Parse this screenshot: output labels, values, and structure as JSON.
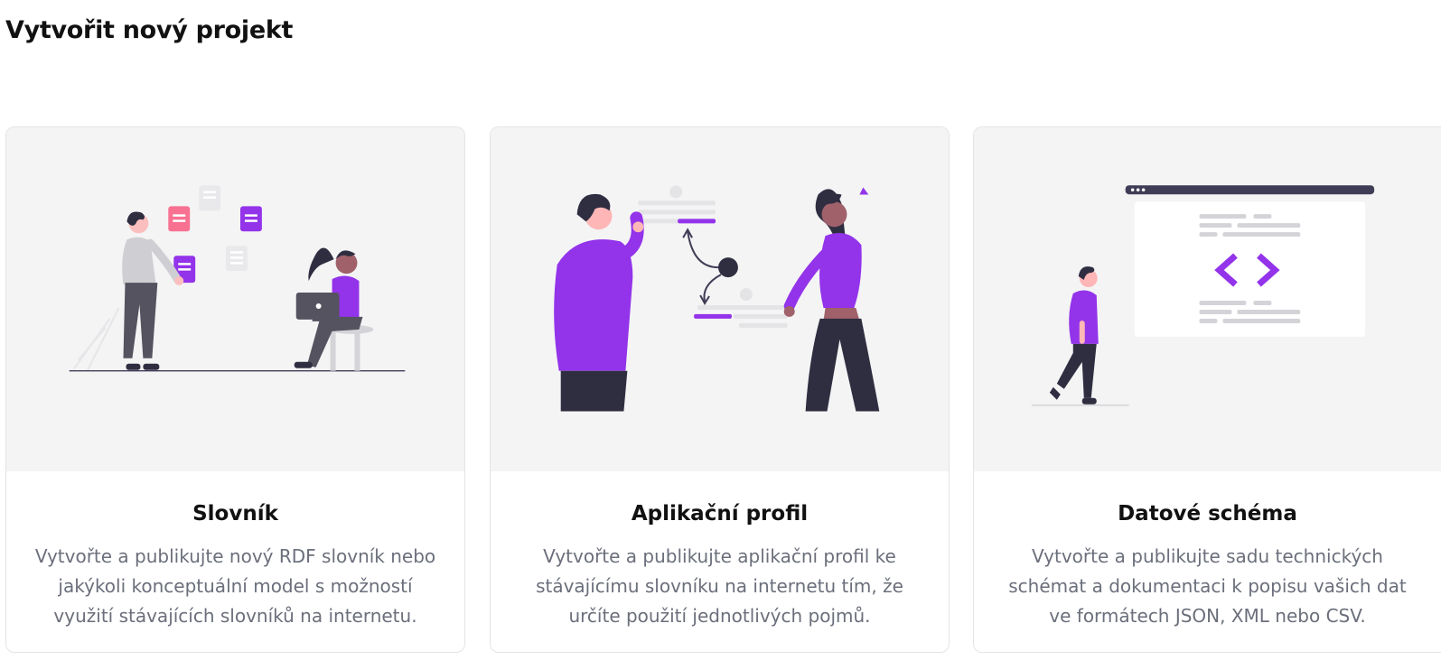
{
  "page": {
    "title": "Vytvořit nový projekt"
  },
  "colors": {
    "accent": "#9333ea",
    "pink": "#f87191",
    "dark": "#2f2e41",
    "card_bg": "#f4f4f5",
    "muted_text": "#6b6f7b"
  },
  "cards": [
    {
      "title": "Slovník",
      "description": "Vytvořte a publikujte nový RDF slovník nebo jakýkoli konceptuální model s možností využití stávajících slovníků na internetu.",
      "illustration": "people-with-notes-and-laptop"
    },
    {
      "title": "Aplikační profil",
      "description": "Vytvořte a publikujte aplikační profil ke stávajícímu slovníku na internetu tím, že určíte použití jednotlivých pojmů.",
      "illustration": "two-people-exchanging-data"
    },
    {
      "title": "Datové schéma",
      "description": "Vytvořte a publikujte sadu technických schémat a dokumentaci k popisu vašich dat ve formátech JSON, XML nebo CSV.",
      "illustration": "person-walking-to-code-window"
    }
  ]
}
